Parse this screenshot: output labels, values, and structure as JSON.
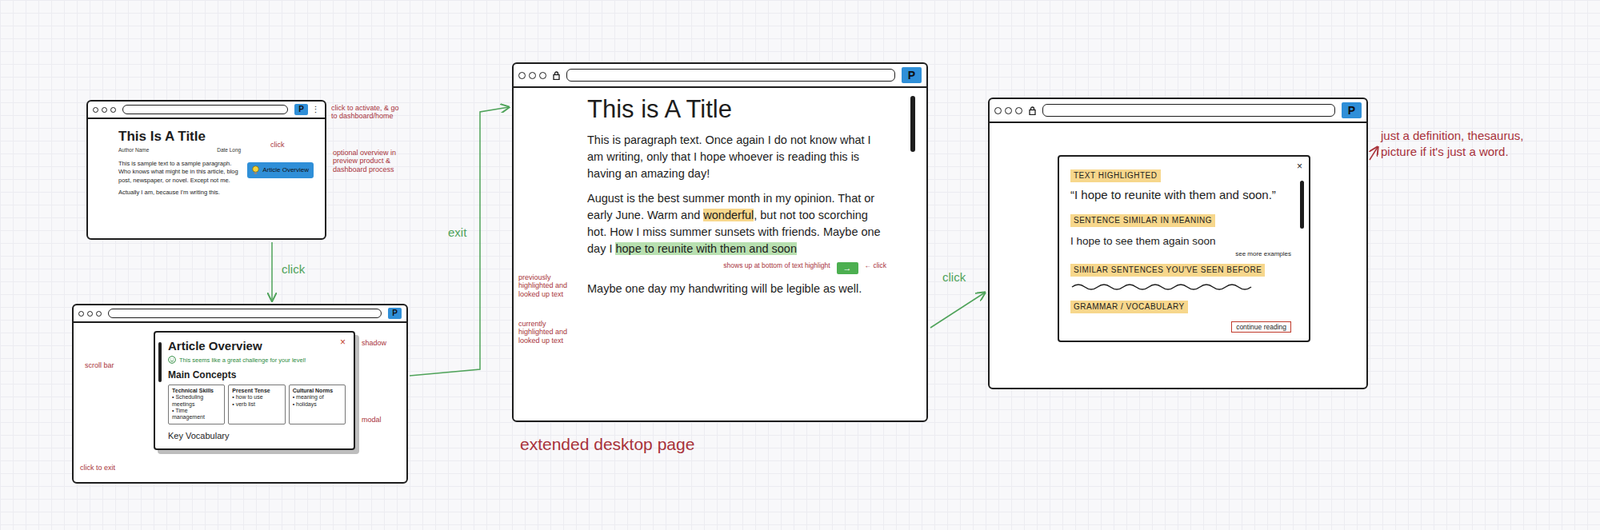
{
  "preview_window": {
    "logo": "P",
    "menu_glyph": "⋮",
    "title": "This Is A Title",
    "byline": [
      "Author Name",
      "Date Long"
    ],
    "body": [
      "This is sample text to a sample paragraph. Who knows what might be in this article, blog post, newspaper, or novel. Except not me.",
      "Actually I am, because I'm writing this."
    ],
    "overview_button": "Article Overview",
    "notes": [
      "click to activate, & go to dashboard/home",
      "click",
      "optional overview in preview product & dashboard process"
    ]
  },
  "overview_window": {
    "logo": "P",
    "modal": {
      "title": "Article Overview",
      "close": "×",
      "level_message": "This seems like a great challenge for your level!",
      "concepts_heading": "Main Concepts",
      "concepts": [
        {
          "title": "Technical Skills",
          "points": [
            "• Scheduling meetings",
            "• Time management"
          ]
        },
        {
          "title": "Present Tense",
          "points": [
            "• how to use",
            "• verb list"
          ]
        },
        {
          "title": "Cultural Norms",
          "points": [
            "• meaning of",
            "• holidays"
          ]
        }
      ],
      "vocabulary_heading": "Key Vocabulary"
    },
    "notes": [
      "shadow",
      "scroll bar",
      "modal",
      "click to exit"
    ]
  },
  "reader_window": {
    "logo": "P",
    "title": "This is A Title",
    "paragraphs": [
      [
        {
          "text": "This is paragraph text. Once again I do not know what I am writing, only that I hope whoever is reading this is having an amazing day!",
          "kind": "plain"
        }
      ],
      [
        {
          "text": "August is the best summer month in my opinion. That or early June. Warm and ",
          "kind": "plain"
        },
        {
          "text": "wonderful",
          "kind": "previous"
        },
        {
          "text": ", but not too scorching hot. How I miss summer sunsets with friends. Maybe one day I ",
          "kind": "plain"
        },
        {
          "text": "hope to reunite with them and soon",
          "kind": "current"
        }
      ],
      [
        {
          "text": "Maybe one day my handwriting will be legible as well.",
          "kind": "plain"
        }
      ]
    ],
    "lookup": {
      "note": "shows up at bottom of text highlight",
      "button": "→",
      "click_note": "← click"
    },
    "notes": [
      "previously highlighted and looked up text",
      "currently highlighted and looked up text"
    ],
    "caption": "extended desktop page"
  },
  "lookup_window": {
    "logo": "P",
    "panel": {
      "close": "×",
      "highlight_label": "TEXT HIGHLIGHTED",
      "quote": "“I hope to reunite with them and soon.”",
      "similar_label": "SENTENCE SIMILAR IN MEANING",
      "similar_sentence": "I hope to see them again soon",
      "more_examples": "see more examples",
      "seen_label": "SIMILAR SENTENCES YOU'VE SEEN BEFORE",
      "grammar_label": "GRAMMAR / VOCABULARY",
      "continue": "continue reading"
    },
    "notes": [
      "just a definition, thesaurus, picture if it's just a word."
    ]
  },
  "arrows": [
    {
      "label": "click"
    },
    {
      "label": "exit"
    },
    {
      "label": "click"
    }
  ]
}
